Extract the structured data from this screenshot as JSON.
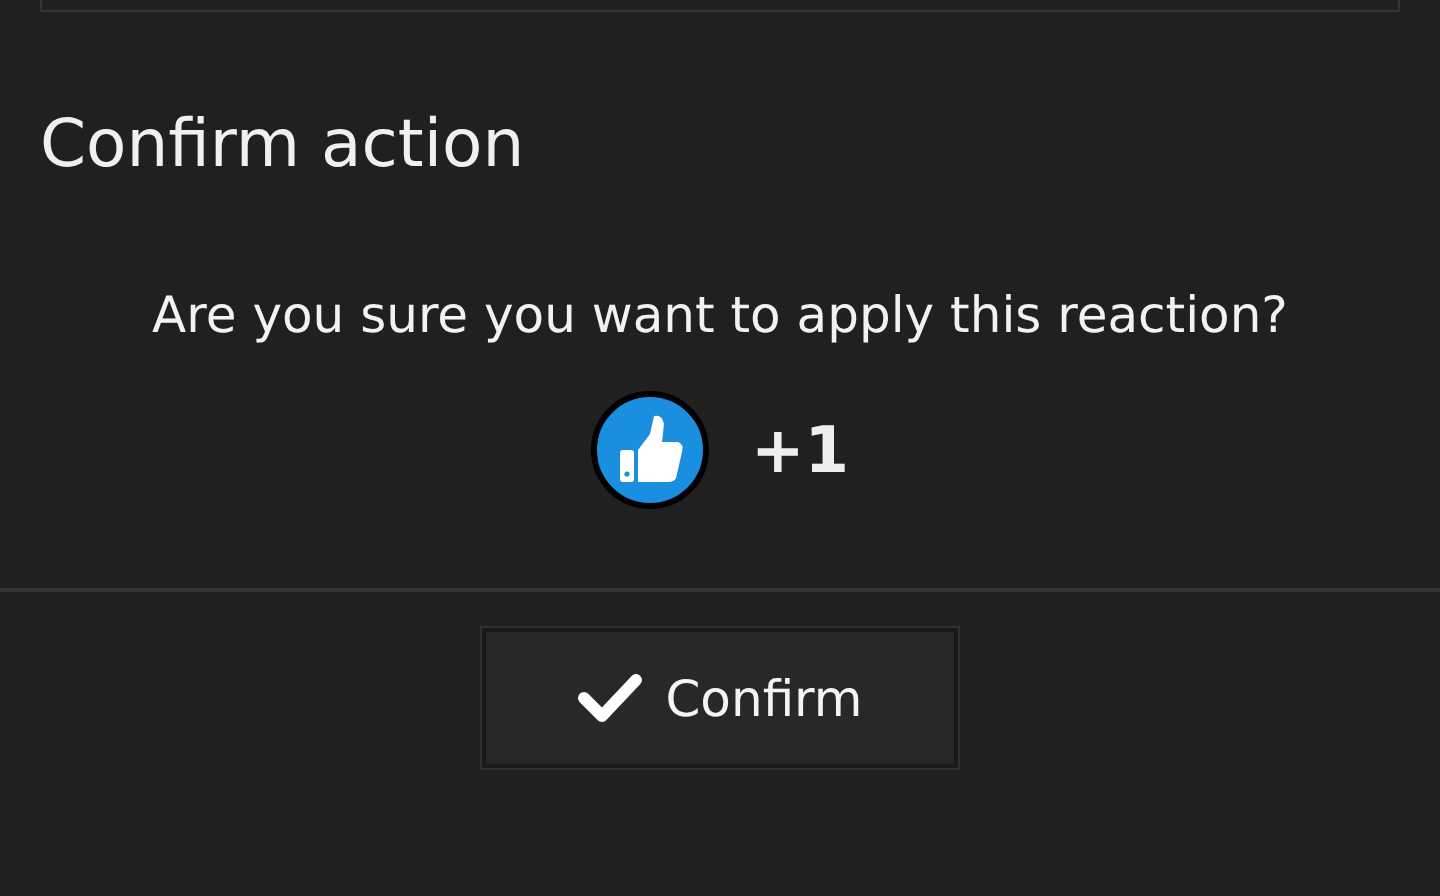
{
  "dialog": {
    "title": "Confirm action",
    "message": "Are you sure you want to apply this reaction?",
    "reaction": {
      "count": "+1"
    },
    "buttons": [
      {
        "label": "Confirm"
      }
    ]
  }
}
